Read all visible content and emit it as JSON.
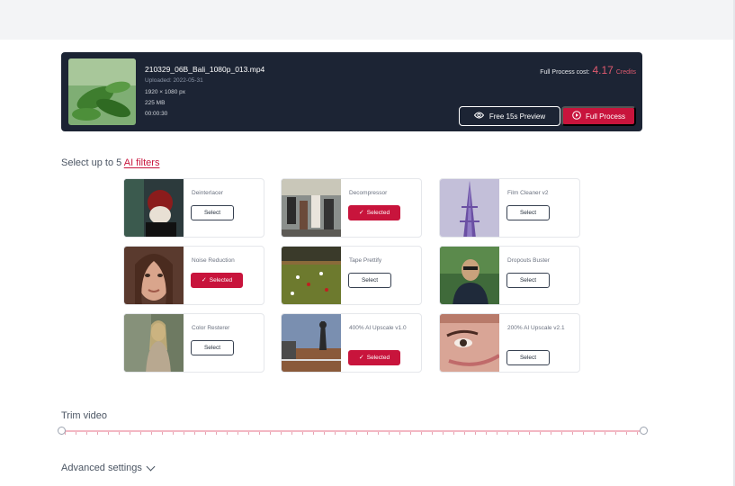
{
  "video": {
    "file_name": "210329_06B_Bali_1080p_013.mp4",
    "uploaded": "Uploaded: 2022-05-31",
    "resolution": "1920 × 1080 px",
    "size": "225 MB",
    "duration": "00:00:30",
    "cost_label": "Full Process cost:",
    "cost_value": "4.17",
    "cost_unit": "Credits",
    "preview_label": "Free 15s Preview",
    "full_label": "Full Process"
  },
  "filters_heading": {
    "prefix": "Select up to 5",
    "link": "AI filters"
  },
  "filters": [
    {
      "name": "Deinterlacer",
      "button": "Select",
      "selected": false
    },
    {
      "name": "Decompressor",
      "button": "Selected",
      "selected": true
    },
    {
      "name": "Film Cleaner v2",
      "button": "Select",
      "selected": false
    },
    {
      "name": "Noise Reduction",
      "button": "Selected",
      "selected": true
    },
    {
      "name": "Tape Prettify",
      "button": "Select",
      "selected": false
    },
    {
      "name": "Dropouts Buster",
      "button": "Select",
      "selected": false
    },
    {
      "name": "Color Resterer",
      "button": "Select",
      "selected": false
    },
    {
      "name": "400% AI Upscale v1.0",
      "button": "Selected",
      "selected": true
    },
    {
      "name": "200% AI Upscale v2.1",
      "button": "Select",
      "selected": false
    }
  ],
  "trim": {
    "label": "Trim video",
    "start": 0,
    "end": 1
  },
  "advanced": {
    "label": "Advanced settings"
  },
  "colors": {
    "accent": "#c8143c",
    "card_bg": "#1c2434"
  },
  "icons": {
    "preview": "eye-icon",
    "full": "play-circle-icon",
    "selected": "check-icon",
    "advanced": "chevron-down-icon"
  }
}
